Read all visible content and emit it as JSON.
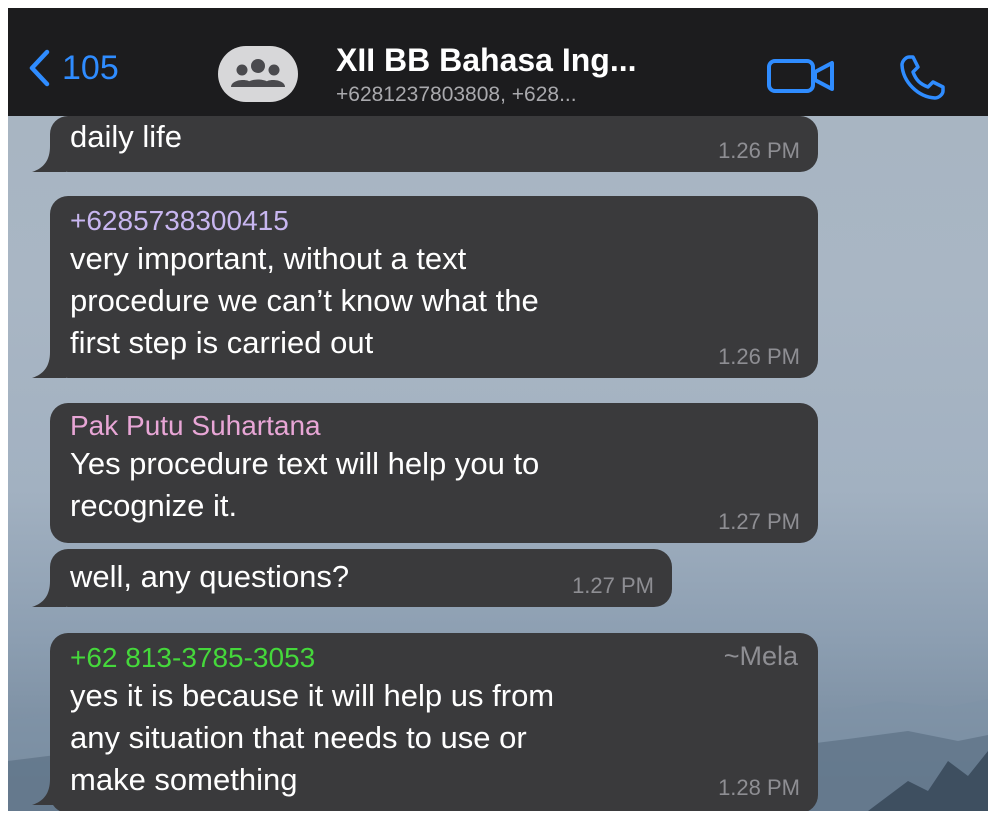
{
  "header": {
    "back_count": "105",
    "title": "XII BB Bahasa Ing...",
    "subtitle": "+6281237803808, +628..."
  },
  "colors": {
    "header_bg": "#1c1c1e",
    "accent": "#2f8cff",
    "bubble_bg": "#3a3a3c",
    "sender_purple": "#c8b6f0",
    "sender_pink": "#e8a6d6",
    "sender_green": "#45d83b"
  },
  "icons": [
    "chevron-left-icon",
    "group-avatar-icon",
    "video-camera-icon",
    "phone-icon"
  ],
  "messages": [
    {
      "sender": "",
      "alias": "",
      "text": "daily life",
      "time": "1.26 PM"
    },
    {
      "sender": "+6285738300415",
      "alias": "",
      "text": "very important, without a text\nprocedure we can’t know what the\nfirst step is carried out",
      "time": "1.26 PM"
    },
    {
      "sender": "Pak Putu Suhartana",
      "alias": "",
      "text": "Yes procedure text will help you to\nrecognize it.",
      "time": "1.27 PM"
    },
    {
      "sender": "",
      "alias": "",
      "text": "well, any questions?",
      "time": "1.27 PM"
    },
    {
      "sender": "+62 813-3785-3053",
      "alias": "~Mela",
      "text": "yes it is because it will help us from\nany situation that needs to use or\nmake something",
      "time": "1.28 PM"
    }
  ]
}
